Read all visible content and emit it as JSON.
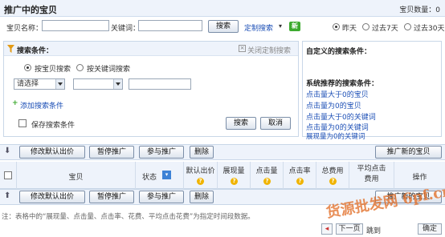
{
  "header": {
    "title": "推广中的宝贝",
    "count_text": "宝贝数量：0"
  },
  "search": {
    "item_name_label": "宝贝名称：",
    "item_name_value": "",
    "keyword_label": "关键词：",
    "keyword_value": "",
    "search_button": "搜索",
    "custom_search_link": "定制搜索",
    "new_badge": "新",
    "time_options": [
      "昨天",
      "过去7天",
      "过去30天"
    ]
  },
  "conditions": {
    "title": "搜索条件：",
    "close_custom": "关闭定制搜索",
    "mode_options": [
      "按宝贝搜索",
      "按关键词搜索"
    ],
    "select1": "请选择",
    "select2": "",
    "value": "",
    "add_condition": "添加搜索条件",
    "save_label": "保存搜索条件",
    "search_button": "搜索",
    "cancel_button": "取消"
  },
  "custom_panel": {
    "title": "自定义的搜索条件：",
    "recommended_title": "系统推荐的搜索条件：",
    "items": [
      "点击量大于0的宝贝",
      "点击量为0的宝贝",
      "点击量大于0的关键词",
      "点击量为0的关键词",
      "展现量为0的关键词"
    ]
  },
  "toolbar": {
    "buttons": [
      "修改默认出价",
      "暂停推广",
      "参与推广",
      "删除"
    ],
    "promote_new": "推广新的宝贝"
  },
  "table": {
    "columns": [
      "宝贝",
      "状态",
      "默认出价",
      "展现量",
      "点击量",
      "点击率",
      "总费用",
      "平均点击费用",
      "操作"
    ]
  },
  "footer": {
    "note": "注：表格中的“展现量、点击量、点击率、花费、平均点击花费”为指定时间段数据。",
    "prev": "◂",
    "next": "下一页",
    "jump": "跳到",
    "confirm": "确定"
  },
  "watermark": "货源批发网 6pf.cn",
  "colors": {
    "link": "#1c4fb6",
    "header_bg": "#eef3fb",
    "border": "#c9d7e8",
    "help": "#f0b400",
    "new_badge": "#3daa2f"
  }
}
